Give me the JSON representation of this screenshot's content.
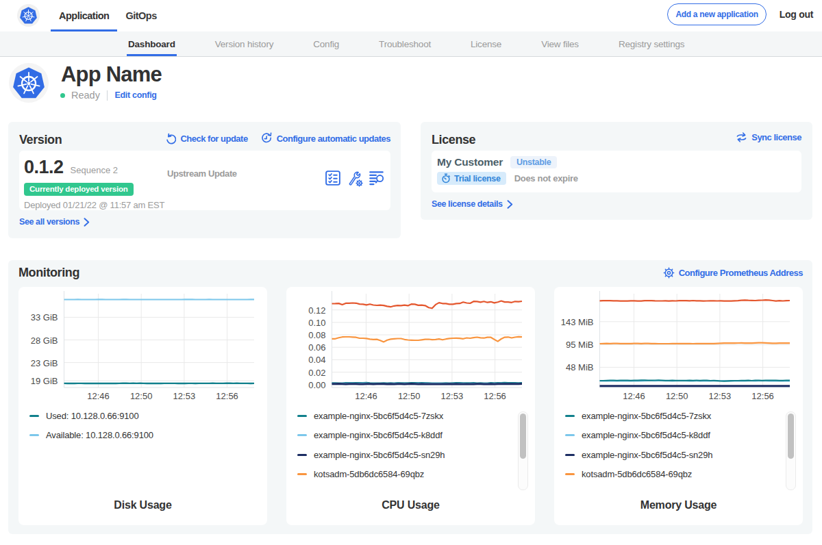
{
  "colors": {
    "link_blue": "#326de6",
    "success_green": "#31c78e",
    "card_bg": "#f4f7f8",
    "teal": "#11808c",
    "light_blue": "#7cc7eb",
    "navy": "#1c2d63",
    "orange": "#f9953f",
    "red_orange": "#e4572e"
  },
  "topbar": {
    "tabs": [
      {
        "label": "Application",
        "active": true
      },
      {
        "label": "GitOps",
        "active": false
      }
    ],
    "add_button": "Add a new application",
    "logout": "Log out"
  },
  "subnav": {
    "tabs": [
      {
        "label": "Dashboard",
        "active": true
      },
      {
        "label": "Version history",
        "active": false
      },
      {
        "label": "Config",
        "active": false
      },
      {
        "label": "Troubleshoot",
        "active": false
      },
      {
        "label": "License",
        "active": false
      },
      {
        "label": "View files",
        "active": false
      },
      {
        "label": "Registry settings",
        "active": false
      }
    ]
  },
  "app": {
    "name": "App Name",
    "status": "Ready",
    "edit_config": "Edit config"
  },
  "version": {
    "title": "Version",
    "check_for_update": "Check for update",
    "configure_auto_updates": "Configure automatic updates",
    "number": "0.1.2",
    "sequence": "Sequence 2",
    "deployed_badge": "Currently deployed version",
    "deployed_at": "Deployed 01/21/22 @ 11:57 am EST",
    "upstream": "Upstream Update",
    "see_all": "See all versions"
  },
  "license": {
    "title": "License",
    "sync": "Sync license",
    "customer": "My Customer",
    "channel": "Unstable",
    "type_badge": "Trial license",
    "expiry": "Does not expire",
    "see_details": "See license details"
  },
  "monitoring": {
    "title": "Monitoring",
    "configure": "Configure Prometheus Address"
  },
  "chart_data": [
    {
      "type": "line",
      "title": "Disk Usage",
      "x_ticks": [
        {
          "label": "12:46",
          "frac": 0.18
        },
        {
          "label": "12:50",
          "frac": 0.406
        },
        {
          "label": "12:53",
          "frac": 0.632
        },
        {
          "label": "12:56",
          "frac": 0.858
        }
      ],
      "y_ticks": [
        {
          "label": "33 GiB",
          "value": 33
        },
        {
          "label": "28 GiB",
          "value": 28
        },
        {
          "label": "23 GiB",
          "value": 23
        },
        {
          "label": "19 GiB",
          "value": 19
        }
      ],
      "ylim": [
        17.5,
        38.2
      ],
      "legend_scroll": false,
      "series": [
        {
          "name": "Used: 10.128.0.66:9100",
          "color": "#11808c",
          "width": 2.4,
          "in_legend": true,
          "values": [
            18.42,
            18.41,
            18.42,
            18.41,
            18.42,
            18.42,
            18.41,
            18.41,
            18.41,
            18.41,
            18.41,
            18.41,
            18.41,
            18.42,
            18.41,
            18.41,
            18.42,
            18.43,
            18.43,
            18.42,
            18.43,
            18.42,
            18.43,
            18.42,
            18.41,
            18.41,
            18.41,
            18.42,
            18.41,
            18.42,
            18.42,
            18.42,
            18.42,
            18.41,
            18.41,
            18.41,
            18.42,
            18.42,
            18.41,
            18.42,
            18.42,
            18.42,
            18.42,
            18.43,
            18.42,
            18.42,
            18.42,
            18.43,
            18.43,
            18.42,
            18.43,
            18.42,
            18.42,
            18.42,
            18.41,
            18.42
          ]
        },
        {
          "name": "Available: 10.128.0.66:9100",
          "color": "#7cc7eb",
          "width": 2.2,
          "in_legend": true,
          "values": [
            36.91,
            36.92,
            36.92,
            36.92,
            36.93,
            36.92,
            36.92,
            36.92,
            36.92,
            36.92,
            36.93,
            36.93,
            36.92,
            36.92,
            36.92,
            36.92,
            36.92,
            36.93,
            36.93,
            36.92,
            36.92,
            36.92,
            36.91,
            36.92,
            36.91,
            36.91,
            36.91,
            36.92,
            36.91,
            36.91,
            36.91,
            36.92,
            36.92,
            36.92,
            36.92,
            36.93,
            36.93,
            36.93,
            36.92,
            36.92,
            36.92,
            36.92,
            36.93,
            36.92,
            36.91,
            36.91,
            36.91,
            36.92,
            36.92,
            36.92,
            36.91,
            36.91,
            36.92,
            36.92,
            36.93,
            36.93
          ]
        }
      ]
    },
    {
      "type": "line",
      "title": "CPU Usage",
      "x_ticks": [
        {
          "label": "12:46",
          "frac": 0.18
        },
        {
          "label": "12:50",
          "frac": 0.406
        },
        {
          "label": "12:53",
          "frac": 0.632
        },
        {
          "label": "12:56",
          "frac": 0.858
        }
      ],
      "y_ticks": [
        {
          "label": "0.12",
          "value": 0.12
        },
        {
          "label": "0.10",
          "value": 0.1
        },
        {
          "label": "0.08",
          "value": 0.08
        },
        {
          "label": "0.06",
          "value": 0.06
        },
        {
          "label": "0.04",
          "value": 0.04
        },
        {
          "label": "0.02",
          "value": 0.02
        },
        {
          "label": "0.00",
          "value": 0.0
        }
      ],
      "ylim": [
        -0.0047,
        0.1461
      ],
      "legend_scroll": true,
      "series": [
        {
          "name": "example-nginx-5bc6f5d4c5-7zskx",
          "color": "#11808c",
          "width": 2,
          "in_legend": true,
          "values": [
            0.0027,
            0.0028,
            0.0025,
            0.0023,
            0.003,
            0.003,
            0.0029,
            0.0031,
            0.0029,
            0.0031,
            0.0032,
            0.0027,
            0.0026,
            0.0026,
            0.0025,
            0.0028,
            0.0026,
            0.0027,
            0.0025,
            0.003,
            0.0028,
            0.0028,
            0.0028,
            0.0031,
            0.0029,
            0.0031,
            0.0029,
            0.0029,
            0.0028,
            0.0025,
            0.0026,
            0.0025,
            0.0023,
            0.0028,
            0.0026,
            0.0027,
            0.0029,
            0.0029,
            0.0027,
            0.0028,
            0.0028,
            0.003,
            0.0026,
            0.0028,
            0.0026,
            0.0026,
            0.0029,
            0.0028,
            0.0029,
            0.003,
            0.0032,
            0.0029,
            0.0029,
            0.0029,
            0.0028,
            0.003
          ]
        },
        {
          "name": "example-nginx-5bc6f5d4c5-k8ddf",
          "color": "#7cc7eb",
          "width": 2,
          "in_legend": true,
          "values": [
            0.0018,
            0.0018,
            0.0018,
            0.0021,
            0.002,
            0.0021,
            0.0022,
            0.0018,
            0.0018,
            0.0021,
            0.0021,
            0.0017,
            0.0015,
            0.0017,
            0.0015,
            0.0015,
            0.0014,
            0.0018,
            0.002,
            0.0021,
            0.0017,
            0.0019,
            0.0019,
            0.0016,
            0.002,
            0.0021,
            0.0018,
            0.0021,
            0.0018,
            0.0018,
            0.0021,
            0.0021,
            0.0017,
            0.0017,
            0.0018,
            0.0017,
            0.0016,
            0.0016,
            0.0019,
            0.0015,
            0.0017,
            0.0017,
            0.0015,
            0.0016,
            0.0018,
            0.0018,
            0.0015,
            0.002,
            0.002,
            0.0022,
            0.0017,
            0.0016,
            0.0015,
            0.0018,
            0.0017,
            0.0015
          ]
        },
        {
          "name": "example-nginx-5bc6f5d4c5-sn29h",
          "color": "#1c2d63",
          "width": 3,
          "in_legend": true,
          "values": [
            0.001,
            0.0011,
            0.0012,
            0.001,
            0.0009,
            0.0011,
            0.0011,
            0.0011,
            0.0009,
            0.0008,
            0.001,
            0.001,
            0.0008,
            0.0011,
            0.0011,
            0.0011,
            0.0009,
            0.0011,
            0.0009,
            0.0011,
            0.001,
            0.0009,
            0.001,
            0.0012,
            0.001,
            0.0009,
            0.001,
            0.0009,
            0.0008,
            0.0008,
            0.0008,
            0.0008,
            0.0009,
            0.0009,
            0.001,
            0.0009,
            0.001,
            0.0009,
            0.0009,
            0.0008,
            0.0008,
            0.0008,
            0.001,
            0.001,
            0.0009,
            0.0009,
            0.0011,
            0.0009,
            0.0011,
            0.001,
            0.001,
            0.0011,
            0.001,
            0.001,
            0.0011,
            0.0012
          ]
        },
        {
          "name": "kotsadm-5db6dc6584-69qbz",
          "color": "#f9953f",
          "width": 2.2,
          "in_legend": true,
          "values": [
            0.0736,
            0.0737,
            0.0753,
            0.0765,
            0.0768,
            0.0767,
            0.0764,
            0.076,
            0.0745,
            0.0746,
            0.0741,
            0.073,
            0.0725,
            0.0728,
            0.071,
            0.0686,
            0.0716,
            0.073,
            0.0737,
            0.074,
            0.074,
            0.0726,
            0.0718,
            0.0715,
            0.0713,
            0.0712,
            0.072,
            0.0728,
            0.0729,
            0.0722,
            0.0726,
            0.0733,
            0.072,
            0.0732,
            0.0742,
            0.0745,
            0.0747,
            0.0743,
            0.0737,
            0.0751,
            0.0746,
            0.0755,
            0.0762,
            0.0752,
            0.0749,
            0.0761,
            0.076,
            0.0727,
            0.0695,
            0.0734,
            0.0761,
            0.0764,
            0.0751,
            0.0762,
            0.077,
            0.0765
          ]
        },
        {
          "name": "",
          "color": "#e4572e",
          "width": 2.2,
          "in_legend": false,
          "values": [
            0.1301,
            0.1303,
            0.1306,
            0.1285,
            0.1308,
            0.1309,
            0.1312,
            0.1309,
            0.1295,
            0.1291,
            0.128,
            0.1294,
            0.1279,
            0.1274,
            0.1277,
            0.1273,
            0.1259,
            0.125,
            0.1265,
            0.1272,
            0.1271,
            0.1278,
            0.1269,
            0.1294,
            0.1291,
            0.1275,
            0.1277,
            0.1271,
            0.1239,
            0.1226,
            0.1286,
            0.1317,
            0.1304,
            0.1303,
            0.1291,
            0.1291,
            0.1302,
            0.1305,
            0.1326,
            0.1312,
            0.1307,
            0.1338,
            0.1335,
            0.1324,
            0.1337,
            0.1321,
            0.1331,
            0.1313,
            0.1327,
            0.1345,
            0.1328,
            0.1327,
            0.132,
            0.1337,
            0.1333,
            0.134
          ]
        }
      ]
    },
    {
      "type": "line",
      "title": "Memory Usage",
      "x_ticks": [
        {
          "label": "12:46",
          "frac": 0.18
        },
        {
          "label": "12:50",
          "frac": 0.406
        },
        {
          "label": "12:53",
          "frac": 0.632
        },
        {
          "label": "12:56",
          "frac": 0.858
        }
      ],
      "y_ticks": [
        {
          "label": "143 MiB",
          "value": 143
        },
        {
          "label": "95 MiB",
          "value": 95
        },
        {
          "label": "48 MiB",
          "value": 48
        }
      ],
      "ylim": [
        5.8,
        201.2
      ],
      "legend_scroll": true,
      "series": [
        {
          "name": "example-nginx-5bc6f5d4c5-k8ddf",
          "color": "#7cc7eb",
          "width": 2,
          "in_legend": true,
          "legend_order": 1,
          "values": [
            19.5,
            19.5,
            19.5,
            19.3,
            19.3,
            19.6,
            19.5,
            19.8,
            19.5,
            19.5,
            19.6,
            19.4,
            19.5,
            19.8,
            19.9,
            19.9,
            19.8,
            19.9,
            19.9,
            19.8,
            19.8,
            19.4,
            19.7,
            19.6,
            19.7,
            19.7,
            19.5,
            19.4,
            19.7,
            19.5,
            19.5,
            19.5,
            19.5,
            19.7,
            19.9,
            19.6,
            19.7,
            19.5,
            19.6,
            19.5,
            19.4,
            19.4,
            19.4,
            19.7,
            19.6,
            19.5,
            19.7,
            19.9,
            19.7,
            19.5,
            19.4,
            19.3,
            19.4,
            19.3,
            19.4,
            19.4
          ]
        },
        {
          "name": "example-nginx-5bc6f5d4c5-7zskx",
          "color": "#11808c",
          "width": 2.2,
          "in_legend": true,
          "legend_order": 0,
          "values": [
            20.0,
            20.1,
            20.4,
            20.5,
            20.6,
            20.4,
            20.5,
            20.5,
            20.5,
            20.3,
            20.7,
            20.5,
            20.9,
            21.1,
            20.5,
            20.6,
            20.8,
            21.0,
            20.7,
            20.4,
            20.3,
            20.7,
            20.3,
            20.4,
            20.2,
            20.3,
            20.6,
            20.2,
            20.5,
            20.4,
            20.6,
            20.6,
            20.1,
            20.2,
            19.9,
            19.3,
            19.1,
            19.5,
            19.8,
            20.0,
            20.1,
            20.2,
            20.2,
            20.6,
            20.1,
            20.5,
            20.7,
            20.3,
            20.7,
            20.7,
            20.8,
            20.5,
            20.4,
            20.4,
            20.8,
            20.7
          ]
        },
        {
          "name": "example-nginx-5bc6f5d4c5-sn29h",
          "color": "#1c2d63",
          "width": 3,
          "in_legend": true,
          "legend_order": 2,
          "values": [
            9.0,
            9.1,
            9.1,
            9.0,
            9.0,
            9.0,
            9.0,
            9.0,
            8.9,
            8.9,
            9.0,
            9.0,
            9.0,
            9.0,
            9.1,
            9.0,
            9.0,
            8.9,
            9.0,
            9.0,
            9.1,
            9.1,
            9.1,
            9.0,
            8.9,
            9.0,
            9.1,
            9.0,
            9.0,
            8.9,
            9.0,
            9.0,
            9.1,
            9.1,
            9.1,
            9.0,
            8.9,
            8.9,
            9.0,
            9.0,
            9.1,
            9.1,
            9.0,
            9.1,
            9.0,
            9.0,
            8.9,
            9.0,
            9.0,
            9.0,
            9.0,
            9.0,
            8.9,
            8.9,
            9.0,
            9.0
          ]
        },
        {
          "name": "kotsadm-5db6dc6584-69qbz",
          "color": "#f9953f",
          "width": 2.2,
          "in_legend": true,
          "legend_order": 3,
          "values": [
            97.1,
            97.4,
            97.5,
            97.4,
            97.5,
            97.5,
            97.2,
            97.3,
            97.3,
            97.4,
            97.5,
            97.5,
            97.4,
            97.5,
            97.5,
            97.4,
            97.2,
            97.1,
            97.1,
            97.1,
            97.1,
            97.3,
            97.3,
            97.4,
            97.4,
            97.4,
            97.3,
            97.1,
            97.3,
            97.4,
            97.4,
            97.3,
            97.4,
            97.2,
            97.7,
            98.0,
            98.3,
            98.4,
            98.5,
            98.3,
            98.5,
            98.6,
            98.4,
            98.2,
            98.2,
            98.6,
            98.9,
            99.1,
            98.8,
            98.4,
            98.1,
            98.0,
            98.3,
            98.2,
            98.4,
            98.2
          ]
        },
        {
          "name": "",
          "color": "#e4572e",
          "width": 2.2,
          "in_legend": false,
          "values": [
            186.4,
            186.8,
            186.8,
            186.7,
            186.5,
            186.4,
            186.0,
            186.0,
            185.9,
            186.5,
            186.3,
            186.1,
            186.0,
            186.6,
            186.9,
            186.8,
            186.4,
            186.2,
            186.2,
            186.4,
            186.1,
            186.3,
            186.2,
            186.8,
            187.0,
            186.7,
            186.3,
            186.9,
            186.5,
            186.4,
            186.0,
            186.2,
            186.4,
            186.5,
            186.2,
            186.4,
            186.0,
            186.1,
            186.0,
            186.5,
            186.8,
            187.3,
            187.8,
            187.4,
            187.2,
            186.9,
            187.4,
            187.7,
            188.1,
            188.0,
            186.9,
            186.1,
            186.6,
            186.2,
            186.7,
            186.9
          ]
        }
      ]
    }
  ]
}
